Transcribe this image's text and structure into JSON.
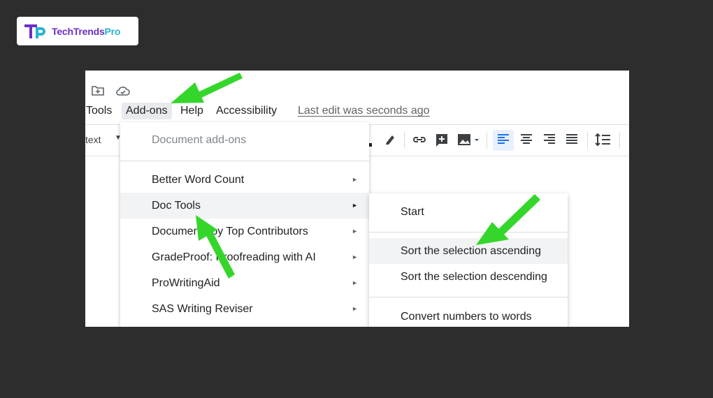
{
  "logo": {
    "text_part1": "TechTrends",
    "text_part2": "Pro"
  },
  "menubar": {
    "tools": "Tools",
    "addons": "Add-ons",
    "help": "Help",
    "accessibility": "Accessibility",
    "last_edit": "Last edit was seconds ago"
  },
  "toolbar": {
    "style_text": "text"
  },
  "addons_menu": {
    "header": "Document add-ons",
    "items": [
      {
        "label": "Better Word Count"
      },
      {
        "label": "Doc Tools"
      },
      {
        "label": "Documents by Top Contributors"
      },
      {
        "label": "GradeProof: Proofreading with AI"
      },
      {
        "label": "ProWritingAid"
      },
      {
        "label": "SAS Writing Reviser"
      }
    ],
    "submenu_arrow": "►"
  },
  "doc_tools_submenu": {
    "items": [
      {
        "label": "Start"
      },
      {
        "label": "Sort the selection ascending"
      },
      {
        "label": "Sort the selection descending"
      },
      {
        "label": "Convert numbers to words"
      }
    ]
  },
  "colors": {
    "annotation_arrow": "#35d62b",
    "highlight": "#f1f3f4",
    "brand_purple": "#6b2fc9",
    "brand_cyan": "#2ab3d6"
  }
}
